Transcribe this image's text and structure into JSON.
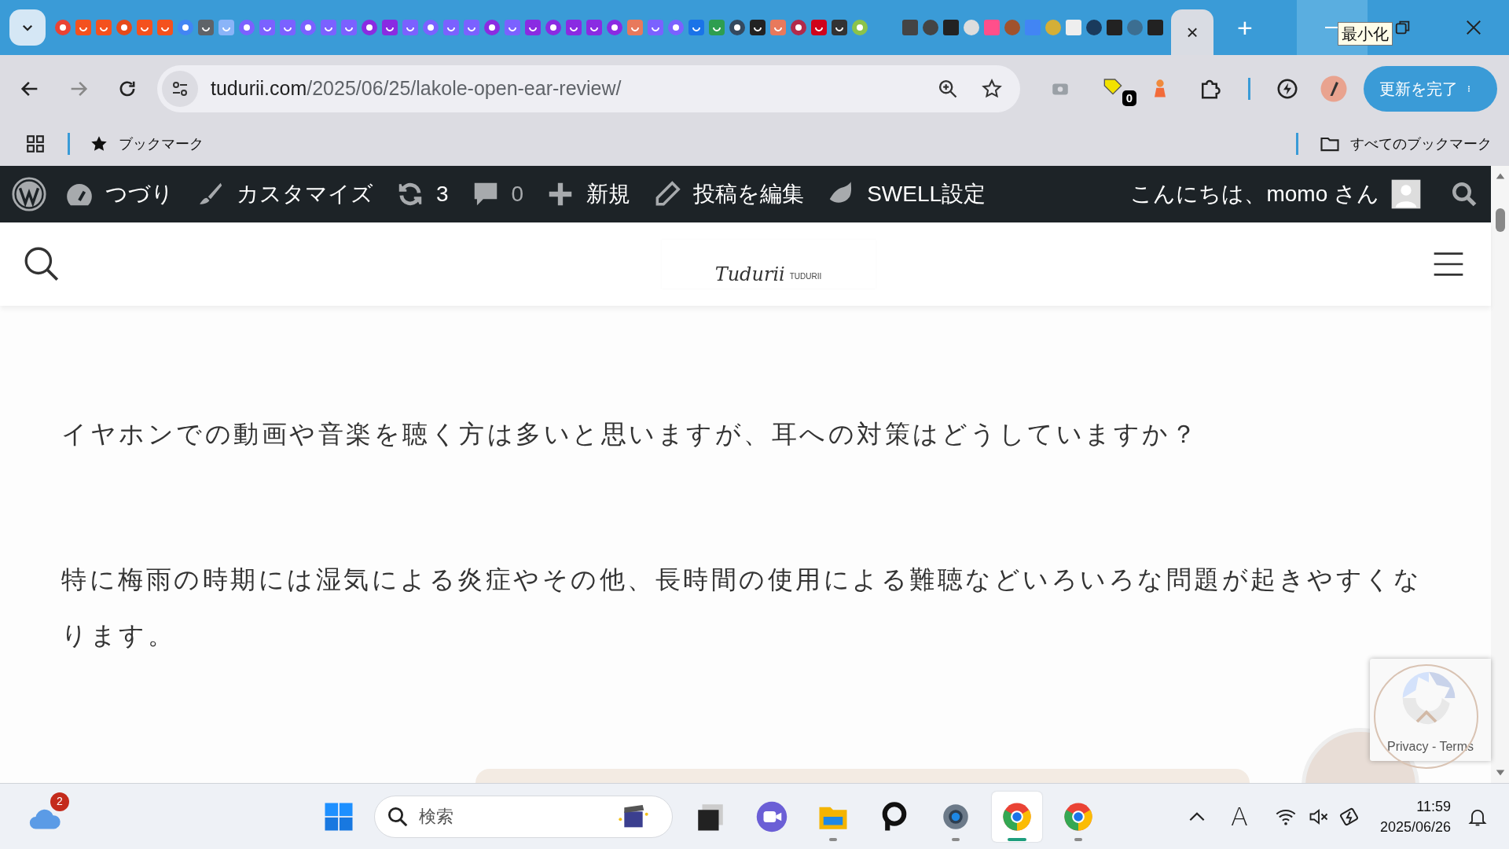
{
  "browser": {
    "active_tab_close": "×",
    "new_tab": "+",
    "tooltip": "最小化",
    "address": {
      "domain": "tudurii.com",
      "path": "/2025/06/25/lakole-open-ear-review/"
    },
    "extension_badge": "0",
    "update_button": "更新を完了",
    "bookmarks": {
      "item": "ブックマーク",
      "all": "すべてのブックマーク"
    }
  },
  "admin_bar": {
    "items": [
      {
        "kind": "wp-logo"
      },
      {
        "kind": "site",
        "label": "つづり"
      },
      {
        "kind": "customize",
        "label": "カスタマイズ"
      },
      {
        "kind": "updates",
        "label": "3"
      },
      {
        "kind": "comments",
        "label": "0"
      },
      {
        "kind": "new",
        "label": "新規"
      },
      {
        "kind": "edit",
        "label": "投稿を編集"
      },
      {
        "kind": "swell",
        "label": "SWELL設定"
      }
    ],
    "greeting": "こんにちは、momo さん"
  },
  "site_header": {
    "logo": {
      "title": "Tudurii",
      "subtitle": "TUDURII"
    }
  },
  "article": {
    "paragraphs": [
      "イヤホンでの動画や音楽を聴く方は多いと思いますが、耳への対策はどうしていますか？",
      "特に梅雨の時期には湿気による炎症やその他、長時間の使用による難聴などいろいろな問題が起きやすくなります。"
    ]
  },
  "recaptcha": {
    "text": "Privacy - Terms"
  },
  "taskbar": {
    "weather_badge": "2",
    "search": {
      "placeholder": "検索"
    },
    "apps": [
      {
        "kind": "taskview",
        "running": false,
        "active": false
      },
      {
        "kind": "meet",
        "running": false,
        "active": false
      },
      {
        "kind": "explorer",
        "running": true,
        "active": false
      },
      {
        "kind": "p-app",
        "running": false,
        "active": false
      },
      {
        "kind": "settings",
        "running": true,
        "active": false
      },
      {
        "kind": "chrome",
        "running": true,
        "active": true
      },
      {
        "kind": "chrome",
        "running": true,
        "active": false
      }
    ],
    "ime": "A",
    "time": "11:59",
    "date": "2025/06/26"
  }
}
